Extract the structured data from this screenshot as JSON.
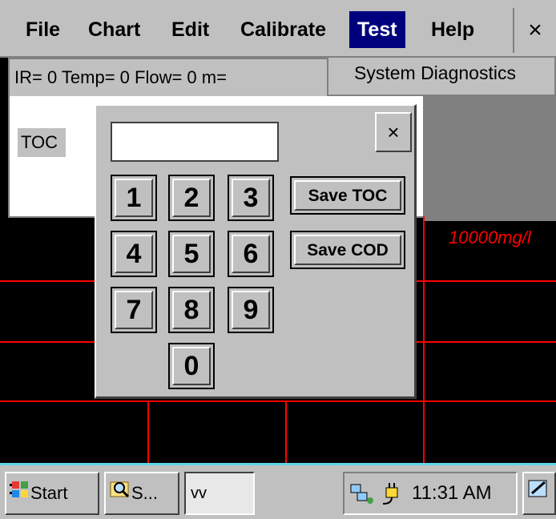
{
  "menubar": {
    "items": [
      {
        "label": "File"
      },
      {
        "label": "Chart"
      },
      {
        "label": "Edit"
      },
      {
        "label": "Calibrate"
      },
      {
        "label": "Test"
      },
      {
        "label": "Help"
      }
    ],
    "close": "×"
  },
  "dropdown": {
    "items": [
      {
        "label": "System Diagnostics"
      }
    ]
  },
  "status": {
    "line": "IR=    0 Temp=  0 Flow=  0 m=",
    "toc_label": "TOC"
  },
  "chart": {
    "label": "10000mg/l"
  },
  "keypad": {
    "input_value": "",
    "close": "×",
    "keys": [
      "1",
      "2",
      "3",
      "4",
      "5",
      "6",
      "7",
      "8",
      "9",
      "0"
    ],
    "save_toc": "Save TOC",
    "save_cod": "Save COD"
  },
  "taskbar": {
    "start": "Start",
    "app": "S...",
    "vv": "vv",
    "clock": "11:31 AM"
  },
  "colors": {
    "menu_active": "#00007f",
    "grid": "#ff0000",
    "chart_label": "#ff0000",
    "taskbar_top": "#5fd7e8"
  }
}
